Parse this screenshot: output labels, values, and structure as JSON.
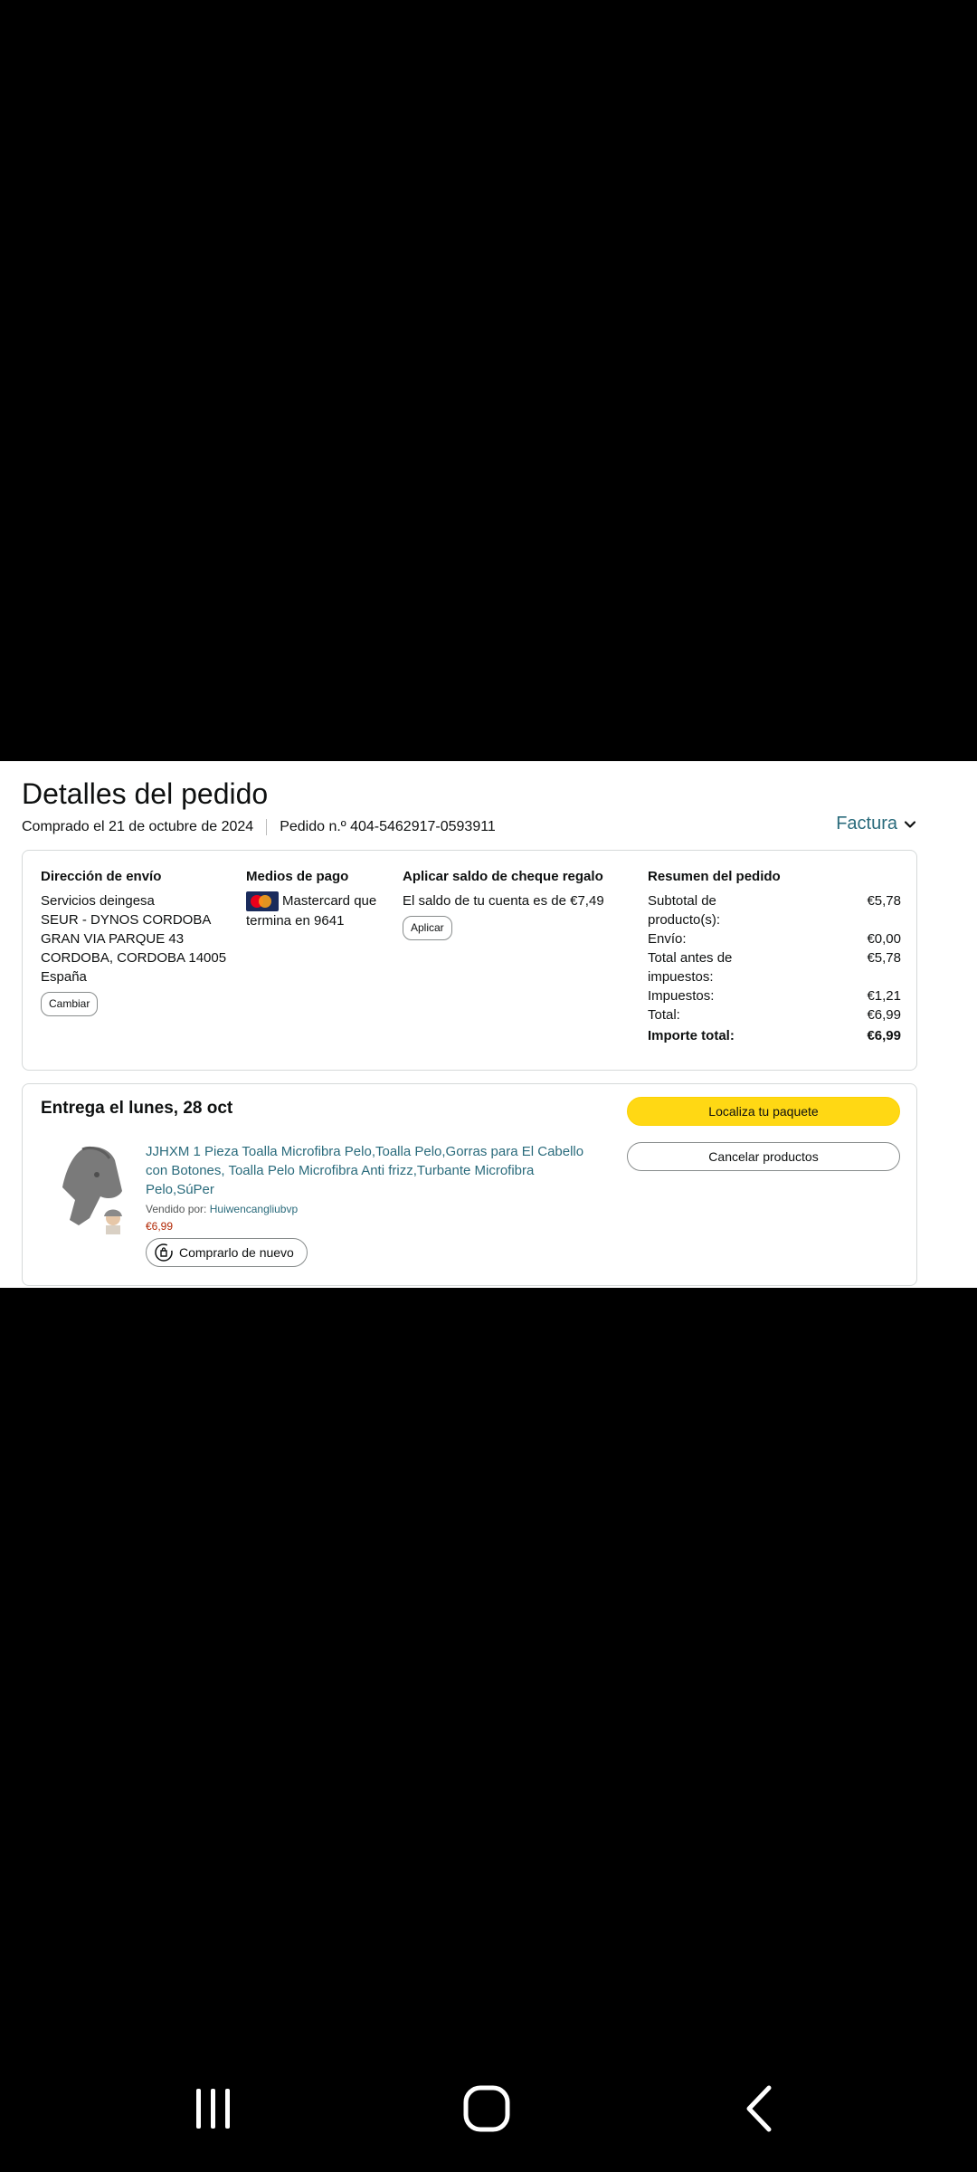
{
  "header": {
    "title": "Detalles del pedido",
    "ordered_on": "Comprado el 21 de octubre de 2024",
    "order_number": "Pedido n.º 404-5462917-0593911",
    "invoice_label": "Factura"
  },
  "shipping": {
    "heading": "Dirección de envío",
    "lines": [
      "Servicios deingesa",
      "SEUR - DYNOS CORDOBA",
      "GRAN VIA PARQUE 43",
      "CORDOBA, CORDOBA 14005",
      "España"
    ],
    "change_label": "Cambiar"
  },
  "payment": {
    "heading": "Medios de pago",
    "card_text": "Mastercard que termina en 9641",
    "card_icon": "mastercard-icon"
  },
  "gift": {
    "heading": "Aplicar saldo de cheque regalo",
    "balance_text": "El saldo de tu cuenta es de €7,49",
    "apply_label": "Aplicar"
  },
  "summary": {
    "heading": "Resumen del pedido",
    "rows": [
      {
        "label": "Subtotal de producto(s):",
        "value": "€5,78"
      },
      {
        "label": "Envío:",
        "value": "€0,00"
      },
      {
        "label": "Total antes de impuestos:",
        "value": "€5,78"
      },
      {
        "label": "Impuestos:",
        "value": "€1,21"
      },
      {
        "label": "Total:",
        "value": "€6,99"
      }
    ],
    "grand_total_label": "Importe total:",
    "grand_total_value": "€6,99"
  },
  "delivery": {
    "heading": "Entrega el lunes, 28 oct",
    "product_title": "JJHXM 1 Pieza Toalla Microfibra Pelo,Toalla Pelo,Gorras para El Cabello con Botones, Toalla Pelo Microfibra Anti frizz,Turbante Microfibra Pelo,SúPer",
    "sold_by_label": "Vendido por:",
    "seller": "Huiwencangliubvp",
    "price": "€6,99",
    "buy_again_label": "Comprarlo de nuevo",
    "track_label": "Localiza tu paquete",
    "cancel_label": "Cancelar productos"
  },
  "colors": {
    "link": "#2a6b7c",
    "price": "#b12704",
    "primary_button": "#ffd814"
  }
}
